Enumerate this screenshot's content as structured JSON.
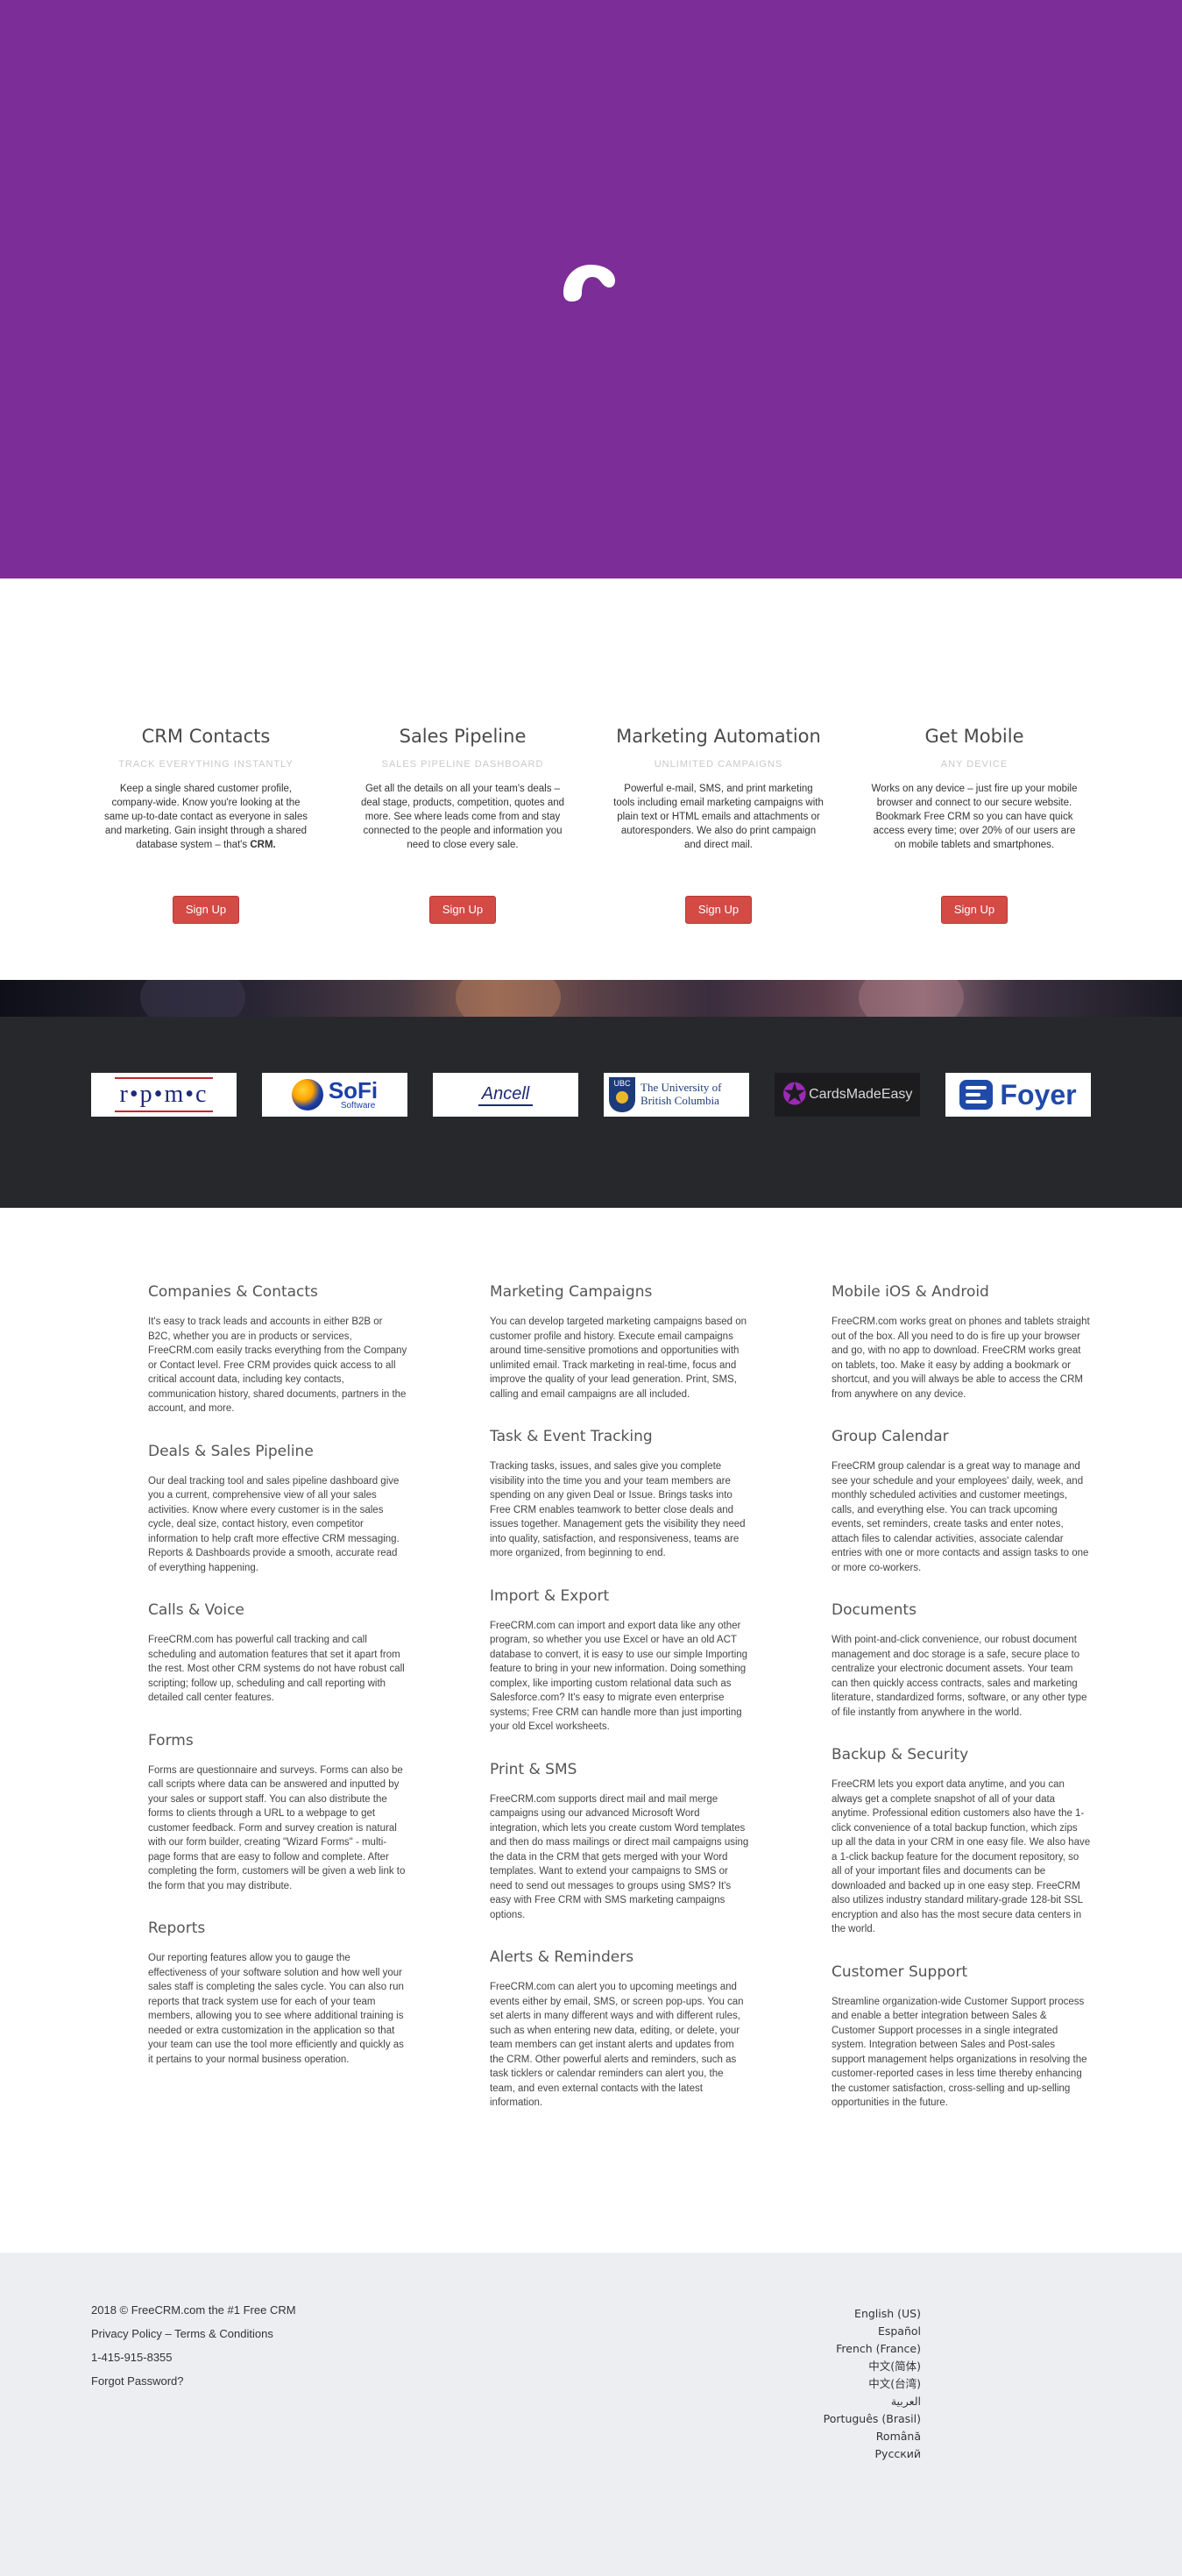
{
  "hero": {
    "background_color": "#7c2d97",
    "logo_icon": "freecrm-swirl-logo"
  },
  "features": [
    {
      "title": "CRM Contacts",
      "subtitle": "TRACK EVERYTHING INSTANTLY",
      "text": "Keep a single shared customer profile, company-wide. Know you're looking at the same up-to-date contact as everyone in sales and marketing. Gain insight through a shared database system – that's ",
      "text_bold": "CRM.",
      "button": "Sign Up"
    },
    {
      "title": "Sales Pipeline",
      "subtitle": "SALES PIPELINE DASHBOARD",
      "text": "Get all the details on all your team's deals – deal stage, products, competition, quotes and more. See where leads come from and stay connected to the people and information you need to close every sale.",
      "button": "Sign Up"
    },
    {
      "title": "Marketing Automation",
      "subtitle": "UNLIMITED CAMPAIGNS",
      "text": "Powerful e-mail, SMS, and print marketing tools including email marketing campaigns with plain text or HTML emails and attachments or autoresponders. We also do print campaign and direct mail.",
      "button": "Sign Up"
    },
    {
      "title": "Get Mobile",
      "subtitle": "ANY DEVICE",
      "text": "Works on any device – just fire up your mobile browser and connect to our secure website. Bookmark Free CRM so you can have quick access every time; over 20% of our users are on mobile tablets and smartphones.",
      "button": "Sign Up"
    }
  ],
  "logos": [
    {
      "name": "ropmoc-logo",
      "text": "r•p•m•c"
    },
    {
      "name": "sofi-logo",
      "text": "SoFi",
      "subtext": "Software"
    },
    {
      "name": "ancell-logo",
      "text": "Ancell"
    },
    {
      "name": "ubc-logo",
      "badge": "UBC",
      "text": "The University of",
      "text2": "British Columbia"
    },
    {
      "name": "cardsmadeeasy-logo",
      "text": "CardsMadeEasy"
    },
    {
      "name": "foyer-logo",
      "text": "Foyer"
    }
  ],
  "columns": [
    [
      {
        "title": "Companies & Contacts",
        "text": "It's easy to track leads and accounts in either B2B or B2C, whether you are in products or services, FreeCRM.com easily tracks everything from the Company or Contact level. Free CRM provides quick access to all critical account data, including key contacts, communication history, shared documents, partners in the account, and more."
      },
      {
        "title": "Deals & Sales Pipeline",
        "text": "Our deal tracking tool and sales pipeline dashboard give you a current, comprehensive view of all your sales activities. Know where every customer is in the sales cycle, deal size, contact history, even competitor information to help craft more effective CRM messaging. Reports & Dashboards provide a smooth, accurate read of everything happening."
      },
      {
        "title": "Calls & Voice",
        "text": "FreeCRM.com has powerful call tracking and call scheduling and automation features that set it apart from the rest. Most other CRM systems do not have robust call scripting; follow up, scheduling and call reporting with detailed call center features."
      },
      {
        "title": "Forms",
        "text": "Forms are questionnaire and surveys. Forms can also be call scripts where data can be answered and inputted by your sales or support staff. You can also distribute the forms to clients through a URL to a webpage to get customer feedback. Form and survey creation is natural with our form builder, creating \"Wizard Forms\" - multi-page forms that are easy to follow and complete. After completing the form, customers will be given a web link to the form that you may distribute."
      },
      {
        "title": "Reports",
        "text": "Our reporting features allow you to gauge the effectiveness of your software solution and how well your sales staff is completing the sales cycle. You can also run reports that track system use for each of your team members, allowing you to see where additional training is needed or extra customization in the application so that your team can use the tool more efficiently and quickly as it pertains to your normal business operation."
      }
    ],
    [
      {
        "title": "Marketing Campaigns",
        "text": "You can develop targeted marketing campaigns based on customer profile and history. Execute email campaigns around time-sensitive promotions and opportunities with unlimited email. Track marketing in real-time, focus and improve the quality of your lead generation. Print, SMS, calling and email campaigns are all included."
      },
      {
        "title": "Task & Event Tracking",
        "text": "Tracking tasks, issues, and sales give you complete visibility into the time you and your team members are spending on any given Deal or Issue. Brings tasks into Free CRM enables teamwork to better close deals and issues together. Management gets the visibility they need into quality, satisfaction, and responsiveness, teams are more organized, from beginning to end."
      },
      {
        "title": "Import & Export",
        "text": "FreeCRM.com can import and export data like any other program, so whether you use Excel or have an old ACT database to convert, it is easy to use our simple Importing feature to bring in your new information. Doing something complex, like importing custom relational data such as Salesforce.com? It's easy to migrate even enterprise systems; Free CRM can handle more than just importing your old Excel worksheets."
      },
      {
        "title": "Print & SMS",
        "text": "FreeCRM.com supports direct mail and mail merge campaigns using our advanced Microsoft Word integration, which lets you create custom Word templates and then do mass mailings or direct mail campaigns using the data in the CRM that gets merged with your Word templates. Want to extend your campaigns to SMS or need to send out messages to groups using SMS? It's easy with Free CRM with SMS marketing campaigns options."
      },
      {
        "title": "Alerts & Reminders",
        "text": "FreeCRM.com can alert you to upcoming meetings and events either by email, SMS, or screen pop-ups. You can set alerts in many different ways and with different rules, such as when entering new data, editing, or delete, your team members can get instant alerts and updates from the CRM. Other powerful alerts and reminders, such as task ticklers or calendar reminders can alert you, the team, and even external contacts with the latest information."
      }
    ],
    [
      {
        "title": "Mobile iOS & Android",
        "text": "FreeCRM.com works great on phones and tablets straight out of the box. All you need to do is fire up your browser and go, with no app to download. FreeCRM works great on tablets, too. Make it easy by adding a bookmark or shortcut, and you will always be able to access the CRM from anywhere on any device."
      },
      {
        "title": "Group Calendar",
        "text": "FreeCRM group calendar is a great way to manage and see your schedule and your employees' daily, week, and monthly scheduled activities and customer meetings, calls, and everything else. You can track upcoming events, set reminders, create tasks and enter notes, attach files to calendar activities, associate calendar entries with one or more contacts and assign tasks to one or more co-workers."
      },
      {
        "title": "Documents",
        "text": "With point-and-click convenience, our robust document management and doc storage is a safe, secure place to centralize your electronic document assets. Your team can then quickly access contracts, sales and marketing literature, standardized forms, software, or any other type of file instantly from anywhere in the world."
      },
      {
        "title": "Backup & Security",
        "text": "FreeCRM lets you export data anytime, and you can always get a complete snapshot of all of your data anytime. Professional edition customers also have the 1-click convenience of a total backup function, which zips up all the data in your CRM in one easy file. We also have a 1-click backup feature for the document repository, so all of your important files and documents can be downloaded and backed up in one easy step. FreeCRM also utilizes industry standard military-grade 128-bit SSL encryption and also has the most secure data centers in the world."
      },
      {
        "title": "Customer Support",
        "text": "Streamline organization-wide Customer Support process and enable a better integration between Sales & Customer Support processes in a single integrated system. Integration between Sales and Post-sales support management helps organizations in resolving the customer-reported cases in less time thereby enhancing the customer satisfaction, cross-selling and up-selling opportunities in the future."
      }
    ]
  ],
  "footer": {
    "copyright": "2018 © FreeCRM.com the #1 Free CRM",
    "privacy": "Privacy Policy",
    "separator": " – ",
    "terms": "Terms & Conditions",
    "phone": "1-415-915-8355",
    "forgot": "Forgot Password?",
    "languages": [
      "English (US)",
      "Español",
      "French (France)",
      "中文(简体)",
      "中文(台湾)",
      "العربية",
      "Português (Brasil)",
      "Română",
      "Русский"
    ]
  },
  "colors": {
    "hero": "#7c2d97",
    "button": "#d44a45",
    "logo_band": "#27282c",
    "footer": "#edeef2"
  }
}
